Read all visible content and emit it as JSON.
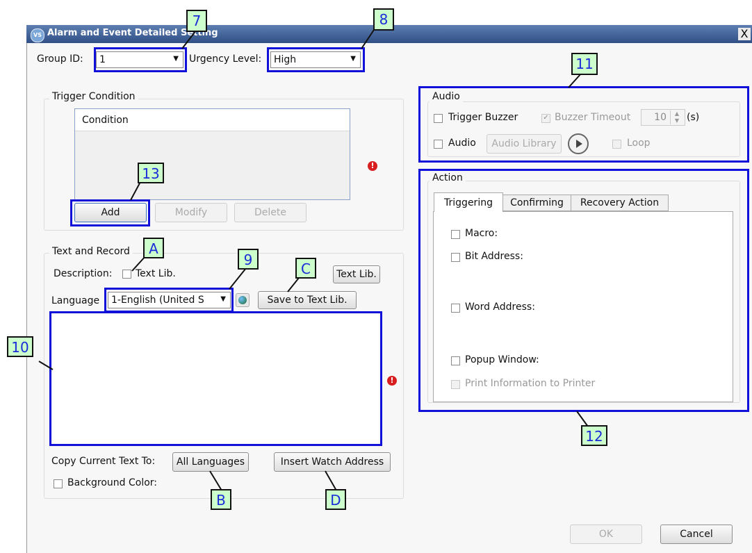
{
  "window": {
    "title": "Alarm and Event Detailed Setting",
    "close_glyph": "X",
    "app_icon_text": "VS"
  },
  "group_id": {
    "label": "Group ID:",
    "value": "1"
  },
  "urgency": {
    "label": "Urgency Level:",
    "value": "High"
  },
  "trigger": {
    "group_label": "Trigger Condition",
    "column_header": "Condition",
    "add": "Add",
    "modify": "Modify",
    "delete": "Delete"
  },
  "text_record": {
    "group_label": "Text and Record",
    "description_label": "Description:",
    "text_lib_checkbox": "Text Lib.",
    "text_lib_button": "Text Lib.",
    "language_label": "Language",
    "language_value": "1-English (United S",
    "save_button": "Save to Text Lib.",
    "copy_label": "Copy Current Text To:",
    "all_languages": "All Languages",
    "insert_watch": "Insert Watch Address",
    "background_color": "Background Color:"
  },
  "audio": {
    "group_label": "Audio",
    "trigger_buzzer": "Trigger Buzzer",
    "buzzer_timeout": "Buzzer Timeout",
    "timeout_value": "10",
    "timeout_unit": "(s)",
    "audio": "Audio",
    "audio_library": "Audio Library",
    "loop": "Loop"
  },
  "action": {
    "group_label": "Action",
    "tabs": [
      "Triggering",
      "Confirming",
      "Recovery Action"
    ],
    "macro": "Macro:",
    "bit_address": "Bit Address:",
    "word_address": "Word Address:",
    "popup_window": "Popup Window:",
    "print_info": "Print Information to Printer"
  },
  "footer": {
    "ok": "OK",
    "cancel": "Cancel"
  },
  "callouts": {
    "c7": "7",
    "c8": "8",
    "c9": "9",
    "c10": "10",
    "c11": "11",
    "c12": "12",
    "c13": "13",
    "cA": "A",
    "cB": "B",
    "cC": "C",
    "cD": "D"
  },
  "colors": {
    "highlight": "#1010d8",
    "callout_bg": "#ccffcc",
    "callout_text": "#1a2dd8",
    "titlebar": "#2f4f86",
    "warning": "#d81e1e"
  }
}
